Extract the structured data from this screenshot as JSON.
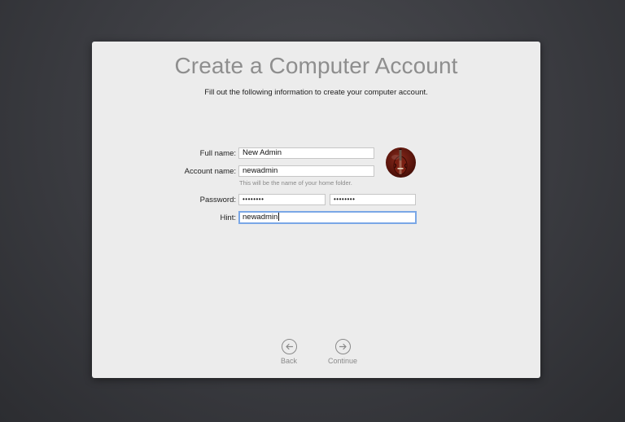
{
  "header": {
    "title": "Create a Computer Account",
    "subtitle": "Fill out the following information to create your computer account."
  },
  "form": {
    "full_name": {
      "label": "Full name:",
      "value": "New Admin"
    },
    "account_name": {
      "label": "Account name:",
      "value": "newadmin",
      "helper": "This will be the name of your home folder."
    },
    "password": {
      "label": "Password:",
      "value": "••••••••",
      "verify_value": "••••••••"
    },
    "hint": {
      "label": "Hint:",
      "value": "newadmin"
    }
  },
  "avatar": {
    "icon": "violin-icon"
  },
  "navigation": {
    "back_label": "Back",
    "continue_label": "Continue"
  },
  "colors": {
    "panel_bg": "#ececec",
    "title": "#8e8e8e",
    "focus_ring": "#7aa7e6",
    "nav": "#8a8a8a"
  }
}
